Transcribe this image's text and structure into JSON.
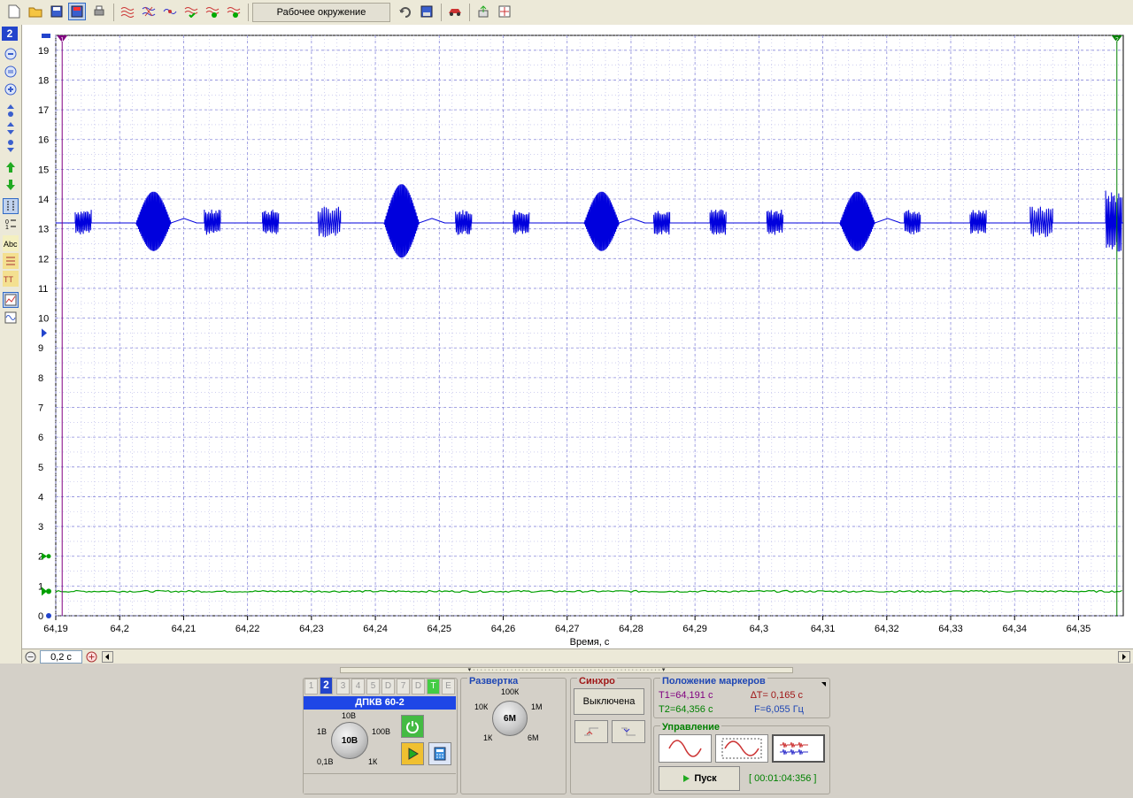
{
  "toolbar": {
    "workspace_label": "Рабочее окружение",
    "icons": [
      "new-file-icon",
      "open-folder-icon",
      "save-icon",
      "save-as-icon",
      "print-icon",
      "waves-icon",
      "waves-cross-icon",
      "waves-link-icon",
      "waves-check-icon",
      "waves-info-icon",
      "waves-ok-icon",
      "undo-icon",
      "save-disk-icon",
      "car-icon",
      "export-icon",
      "fit-icon"
    ]
  },
  "sidebar": {
    "channel_badge": "2",
    "icons": [
      "zoom-out-icon",
      "zoom-fit-icon",
      "zoom-in-icon",
      "scale-up-icon",
      "scale-center-icon",
      "scale-down-icon",
      "arrow-up-green-icon",
      "arrow-down-green-icon",
      "marker-vertical-icon",
      "marker-horizontal-icon",
      "text-label-icon",
      "level-icon",
      "font-icon",
      "chart-view-icon",
      "signal-view-icon"
    ]
  },
  "chart_data": {
    "type": "line",
    "xlabel": "Время, с",
    "ylabel": "",
    "xlim": [
      64.19,
      64.357
    ],
    "ylim": [
      0,
      19.5
    ],
    "x_ticks": [
      "64,19",
      "64,2",
      "64,21",
      "64,22",
      "64,23",
      "64,24",
      "64,25",
      "64,26",
      "64,27",
      "64,28",
      "64,29",
      "64,3",
      "64,31",
      "64,32",
      "64,33",
      "64,34",
      "64,35"
    ],
    "x_tick_values": [
      64.19,
      64.2,
      64.21,
      64.22,
      64.23,
      64.24,
      64.25,
      64.26,
      64.27,
      64.28,
      64.29,
      64.3,
      64.31,
      64.32,
      64.33,
      64.34,
      64.35
    ],
    "y_ticks": [
      "0",
      "1",
      "2",
      "3",
      "4",
      "5",
      "6",
      "7",
      "8",
      "9",
      "10",
      "11",
      "12",
      "13",
      "14",
      "15",
      "16",
      "17",
      "18",
      "19"
    ],
    "grid": true,
    "series": [
      {
        "color": "#0000dd",
        "baseline": 13.2,
        "bursts": [
          {
            "x": 64.1943,
            "amp": 0.45,
            "width": 0.0025
          },
          {
            "x": 64.2053,
            "amp": 1.05,
            "width": 0.0055,
            "big": true
          },
          {
            "x": 64.2145,
            "amp": 0.45,
            "width": 0.0025
          },
          {
            "x": 64.2236,
            "amp": 0.45,
            "width": 0.0025
          },
          {
            "x": 64.2328,
            "amp": 0.55,
            "width": 0.0035
          },
          {
            "x": 64.2441,
            "amp": 1.3,
            "width": 0.0055,
            "big": true
          },
          {
            "x": 64.2538,
            "amp": 0.45,
            "width": 0.0025
          },
          {
            "x": 64.2628,
            "amp": 0.45,
            "width": 0.0025
          },
          {
            "x": 64.2754,
            "amp": 1.05,
            "width": 0.0055,
            "big": true
          },
          {
            "x": 64.2848,
            "amp": 0.45,
            "width": 0.0025
          },
          {
            "x": 64.2936,
            "amp": 0.45,
            "width": 0.0025
          },
          {
            "x": 64.3025,
            "amp": 0.45,
            "width": 0.0025
          },
          {
            "x": 64.3154,
            "amp": 1.05,
            "width": 0.0055,
            "big": true
          },
          {
            "x": 64.324,
            "amp": 0.45,
            "width": 0.0025
          },
          {
            "x": 64.3343,
            "amp": 0.45,
            "width": 0.0025
          },
          {
            "x": 64.3442,
            "amp": 0.55,
            "width": 0.0035
          },
          {
            "x": 64.3555,
            "amp": 1.1,
            "width": 0.0025
          }
        ]
      },
      {
        "color": "#00a000",
        "level": 0.82
      }
    ],
    "markers": [
      {
        "label": "1",
        "x": 64.191,
        "color": "#800080"
      },
      {
        "label": "2",
        "x": 64.356,
        "color": "#008000"
      }
    ]
  },
  "scroll": {
    "timebase": "0,2 с"
  },
  "channel_panel": {
    "tabs": [
      "1",
      "2",
      "3",
      "4",
      "5",
      "D",
      "7",
      "D",
      "T",
      "E"
    ],
    "selected_tab": "2",
    "title": "ДПКВ 60-2",
    "knob_value": "10В",
    "knob_labels": {
      "top": "10В",
      "left": "1В",
      "right": "100В",
      "bottom_left": "0,1В",
      "bottom_right": "1К"
    }
  },
  "sweep_panel": {
    "title": "Развертка",
    "knob_value": "6М",
    "knob_labels": {
      "top": "100К",
      "left": "10К",
      "right": "1М",
      "bottom_left": "1К",
      "bottom_right": "6М"
    }
  },
  "sync_panel": {
    "title": "Синхро",
    "mode": "Выключена"
  },
  "markers_panel": {
    "title": "Положение маркеров",
    "t1": "T1=64,191 с",
    "t2": "T2=64,356 с",
    "dt": "∆T= 0,165 с",
    "freq": "F=6,055 Гц"
  },
  "control_panel": {
    "title": "Управление",
    "start_label": "Пуск",
    "elapsed": "[ 00:01:04:356 ]"
  }
}
